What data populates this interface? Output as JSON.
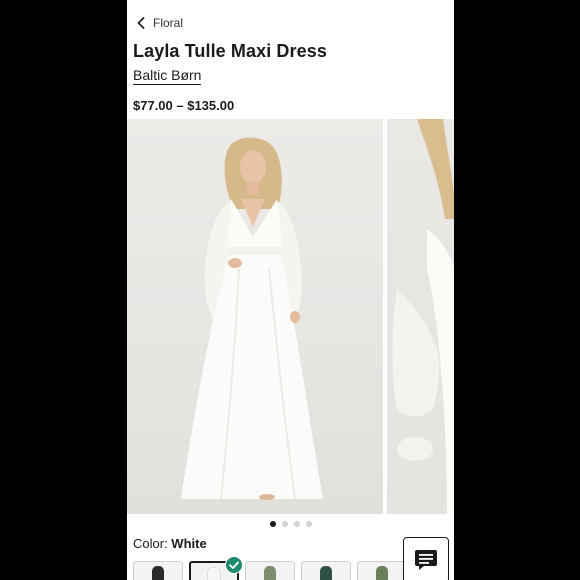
{
  "nav": {
    "back_label": "Floral"
  },
  "product": {
    "title": "Layla Tulle Maxi Dress",
    "brand": "Baltic Børn",
    "price": "$77.00 – $135.00"
  },
  "gallery": {
    "slide_count": 4,
    "active_index": 0
  },
  "color": {
    "label": "Color:",
    "value": "White",
    "swatch_colors": [
      "#2b2b2b",
      "#f6f6f4",
      "#7d8f6e",
      "#2f4f47",
      "#6b7f58"
    ],
    "selected_index": 1
  },
  "accent": {
    "check": "#1f8a70"
  },
  "icons": [
    "chevron-left-icon",
    "check-icon",
    "chat-icon"
  ]
}
